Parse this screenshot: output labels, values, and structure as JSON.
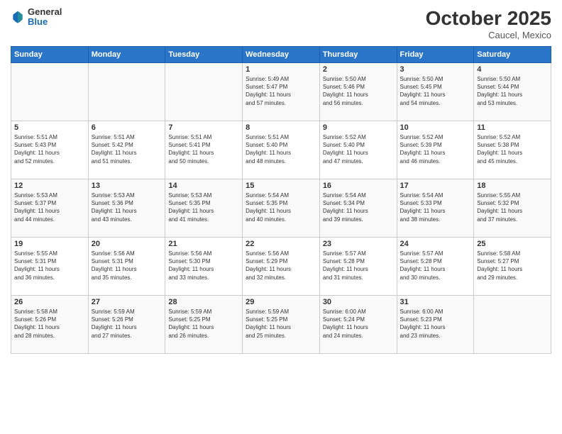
{
  "header": {
    "logo_general": "General",
    "logo_blue": "Blue",
    "month_title": "October 2025",
    "location": "Caucel, Mexico"
  },
  "days_of_week": [
    "Sunday",
    "Monday",
    "Tuesday",
    "Wednesday",
    "Thursday",
    "Friday",
    "Saturday"
  ],
  "weeks": [
    [
      {
        "num": "",
        "info": ""
      },
      {
        "num": "",
        "info": ""
      },
      {
        "num": "",
        "info": ""
      },
      {
        "num": "1",
        "info": "Sunrise: 5:49 AM\nSunset: 5:47 PM\nDaylight: 11 hours\nand 57 minutes."
      },
      {
        "num": "2",
        "info": "Sunrise: 5:50 AM\nSunset: 5:46 PM\nDaylight: 11 hours\nand 56 minutes."
      },
      {
        "num": "3",
        "info": "Sunrise: 5:50 AM\nSunset: 5:45 PM\nDaylight: 11 hours\nand 54 minutes."
      },
      {
        "num": "4",
        "info": "Sunrise: 5:50 AM\nSunset: 5:44 PM\nDaylight: 11 hours\nand 53 minutes."
      }
    ],
    [
      {
        "num": "5",
        "info": "Sunrise: 5:51 AM\nSunset: 5:43 PM\nDaylight: 11 hours\nand 52 minutes."
      },
      {
        "num": "6",
        "info": "Sunrise: 5:51 AM\nSunset: 5:42 PM\nDaylight: 11 hours\nand 51 minutes."
      },
      {
        "num": "7",
        "info": "Sunrise: 5:51 AM\nSunset: 5:41 PM\nDaylight: 11 hours\nand 50 minutes."
      },
      {
        "num": "8",
        "info": "Sunrise: 5:51 AM\nSunset: 5:40 PM\nDaylight: 11 hours\nand 48 minutes."
      },
      {
        "num": "9",
        "info": "Sunrise: 5:52 AM\nSunset: 5:40 PM\nDaylight: 11 hours\nand 47 minutes."
      },
      {
        "num": "10",
        "info": "Sunrise: 5:52 AM\nSunset: 5:39 PM\nDaylight: 11 hours\nand 46 minutes."
      },
      {
        "num": "11",
        "info": "Sunrise: 5:52 AM\nSunset: 5:38 PM\nDaylight: 11 hours\nand 45 minutes."
      }
    ],
    [
      {
        "num": "12",
        "info": "Sunrise: 5:53 AM\nSunset: 5:37 PM\nDaylight: 11 hours\nand 44 minutes."
      },
      {
        "num": "13",
        "info": "Sunrise: 5:53 AM\nSunset: 5:36 PM\nDaylight: 11 hours\nand 43 minutes."
      },
      {
        "num": "14",
        "info": "Sunrise: 5:53 AM\nSunset: 5:35 PM\nDaylight: 11 hours\nand 41 minutes."
      },
      {
        "num": "15",
        "info": "Sunrise: 5:54 AM\nSunset: 5:35 PM\nDaylight: 11 hours\nand 40 minutes."
      },
      {
        "num": "16",
        "info": "Sunrise: 5:54 AM\nSunset: 5:34 PM\nDaylight: 11 hours\nand 39 minutes."
      },
      {
        "num": "17",
        "info": "Sunrise: 5:54 AM\nSunset: 5:33 PM\nDaylight: 11 hours\nand 38 minutes."
      },
      {
        "num": "18",
        "info": "Sunrise: 5:55 AM\nSunset: 5:32 PM\nDaylight: 11 hours\nand 37 minutes."
      }
    ],
    [
      {
        "num": "19",
        "info": "Sunrise: 5:55 AM\nSunset: 5:31 PM\nDaylight: 11 hours\nand 36 minutes."
      },
      {
        "num": "20",
        "info": "Sunrise: 5:56 AM\nSunset: 5:31 PM\nDaylight: 11 hours\nand 35 minutes."
      },
      {
        "num": "21",
        "info": "Sunrise: 5:56 AM\nSunset: 5:30 PM\nDaylight: 11 hours\nand 33 minutes."
      },
      {
        "num": "22",
        "info": "Sunrise: 5:56 AM\nSunset: 5:29 PM\nDaylight: 11 hours\nand 32 minutes."
      },
      {
        "num": "23",
        "info": "Sunrise: 5:57 AM\nSunset: 5:28 PM\nDaylight: 11 hours\nand 31 minutes."
      },
      {
        "num": "24",
        "info": "Sunrise: 5:57 AM\nSunset: 5:28 PM\nDaylight: 11 hours\nand 30 minutes."
      },
      {
        "num": "25",
        "info": "Sunrise: 5:58 AM\nSunset: 5:27 PM\nDaylight: 11 hours\nand 29 minutes."
      }
    ],
    [
      {
        "num": "26",
        "info": "Sunrise: 5:58 AM\nSunset: 5:26 PM\nDaylight: 11 hours\nand 28 minutes."
      },
      {
        "num": "27",
        "info": "Sunrise: 5:59 AM\nSunset: 5:26 PM\nDaylight: 11 hours\nand 27 minutes."
      },
      {
        "num": "28",
        "info": "Sunrise: 5:59 AM\nSunset: 5:25 PM\nDaylight: 11 hours\nand 26 minutes."
      },
      {
        "num": "29",
        "info": "Sunrise: 5:59 AM\nSunset: 5:25 PM\nDaylight: 11 hours\nand 25 minutes."
      },
      {
        "num": "30",
        "info": "Sunrise: 6:00 AM\nSunset: 5:24 PM\nDaylight: 11 hours\nand 24 minutes."
      },
      {
        "num": "31",
        "info": "Sunrise: 6:00 AM\nSunset: 5:23 PM\nDaylight: 11 hours\nand 23 minutes."
      },
      {
        "num": "",
        "info": ""
      }
    ]
  ]
}
